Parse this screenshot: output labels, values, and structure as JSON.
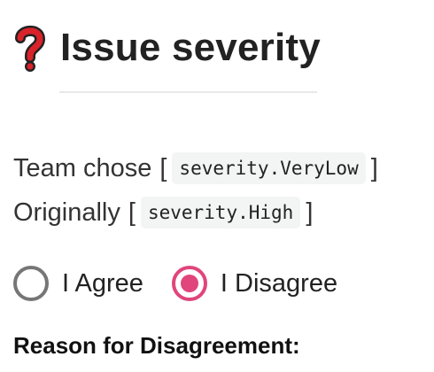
{
  "header": {
    "icon": "red-question-mark-icon",
    "title": "Issue severity"
  },
  "team_choice": {
    "prefix": "Team chose",
    "open_bracket": "[",
    "value": "severity.VeryLow",
    "close_bracket": "]"
  },
  "original": {
    "prefix": "Originally",
    "open_bracket": "[",
    "value": "severity.High",
    "close_bracket": "]"
  },
  "decision": {
    "options": [
      {
        "label": "I Agree",
        "checked": false
      },
      {
        "label": "I Disagree",
        "checked": true
      }
    ]
  },
  "reason": {
    "heading": "Reason for Disagreement:"
  },
  "colors": {
    "accent": "#e0457b",
    "question_icon": "#d9232b",
    "radio_unchecked": "#767676"
  }
}
